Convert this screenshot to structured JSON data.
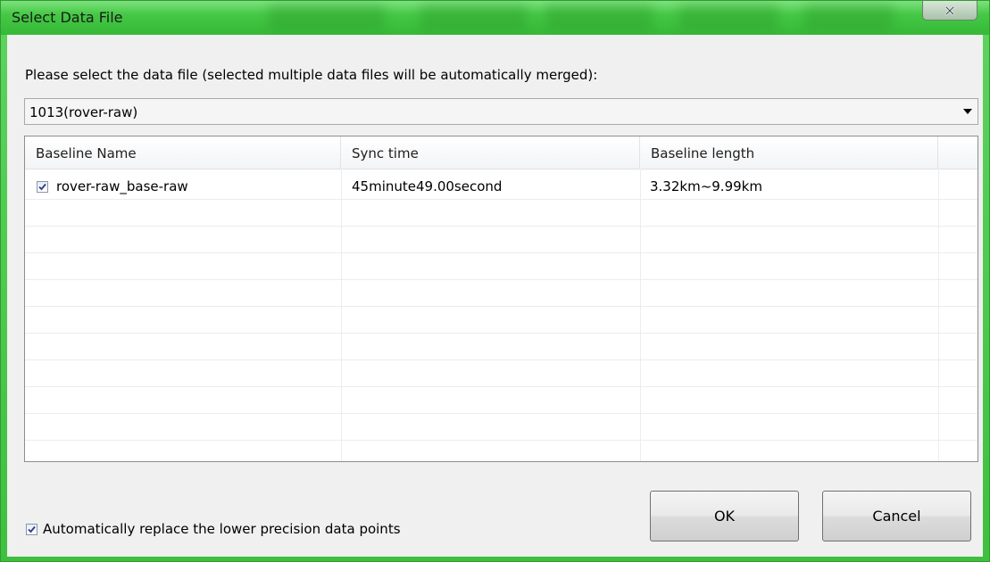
{
  "window": {
    "title": "Select Data File",
    "accent_color": "#3fbf3f",
    "close_icon": "close-icon"
  },
  "prompt": "Please select the data file (selected multiple data files will be automatically merged):",
  "data_file_select": {
    "selected": "1013(rover-raw)"
  },
  "table": {
    "columns": [
      "Baseline Name",
      "Sync time",
      "Baseline length"
    ],
    "rows": [
      {
        "checked": true,
        "name": "rover-raw_base-raw",
        "sync_time": "45minute49.00second",
        "length": "3.32km~9.99km"
      }
    ]
  },
  "auto_replace": {
    "checked": true,
    "label": "Automatically replace the lower precision data points"
  },
  "buttons": {
    "ok": "OK",
    "cancel": "Cancel"
  }
}
